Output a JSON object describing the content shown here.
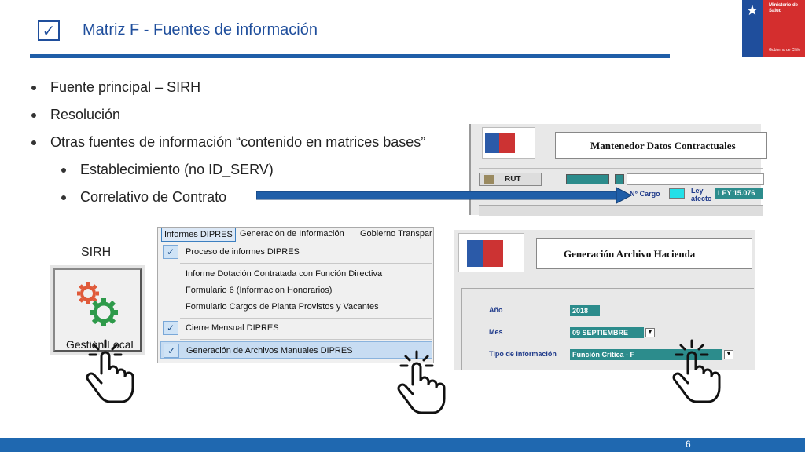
{
  "header": {
    "check_glyph": "✓",
    "title": "Matriz F - Fuentes de información",
    "logo": {
      "line1": "Ministerio de\nSalud",
      "line2": "Gobierno de Chile"
    }
  },
  "bullets": [
    {
      "text": "Fuente principal – SIRH",
      "level": 1
    },
    {
      "text": "Resolución",
      "level": 1
    },
    {
      "text": "Otras fuentes de información “contenido en matrices bases”",
      "level": 1
    },
    {
      "text": "Establecimiento (no ID_SERV)",
      "level": 2
    },
    {
      "text": "Correlativo de Contrato",
      "level": 2
    }
  ],
  "screen_contractuales": {
    "title": "Mantenedor Datos Contractuales",
    "rut_label": "RUT",
    "ncargo_label": "N° Cargo",
    "ley_label": "Ley\nafecto",
    "ley_value": "LEY 15.076"
  },
  "sirh": {
    "label": "SIRH",
    "caption": "Gestión Local"
  },
  "menu": {
    "tabs": [
      "Informes DIPRES",
      "Generación de Información",
      "Gobierno Transpar"
    ],
    "items": [
      {
        "label": "Proceso de informes DIPRES",
        "checked": true
      },
      {
        "label": "Informe Dotación Contratada con Función Directiva",
        "checked": false
      },
      {
        "label": "Formulario 6 (Informacion Honorarios)",
        "checked": false
      },
      {
        "label": "Formulario Cargos de Planta Provistos y Vacantes",
        "checked": false
      },
      {
        "label": "Cierre Mensual DIPRES",
        "checked": true
      },
      {
        "label": "Generación de Archivos Manuales DIPRES",
        "checked": true,
        "highlighted": true
      }
    ],
    "check_glyph": "✓"
  },
  "screen_hacienda": {
    "title": "Generación Archivo Hacienda",
    "fields": [
      {
        "label": "Año",
        "value": "2018",
        "dropdown": false
      },
      {
        "label": "Mes",
        "value": "09 SEPTIEMBRE",
        "dropdown": true
      },
      {
        "label": "Tipo de Información",
        "value": "Función Crítica - F",
        "dropdown": true
      }
    ],
    "dropdown_glyph": "▼"
  },
  "icons": {
    "hand": "pointing-hand-icon",
    "gears": "gears-icon",
    "check": "check-icon",
    "arrow": "arrow-right-icon"
  },
  "colors": {
    "brand_blue": "#1f4e9c",
    "rule_blue": "#1f5ea8",
    "footer_blue": "#1f68b0",
    "field_teal": "#2c8c8c",
    "cyan": "#22e0e8",
    "logo_red": "#d42e2e"
  },
  "footer": {
    "page_number": "6"
  }
}
